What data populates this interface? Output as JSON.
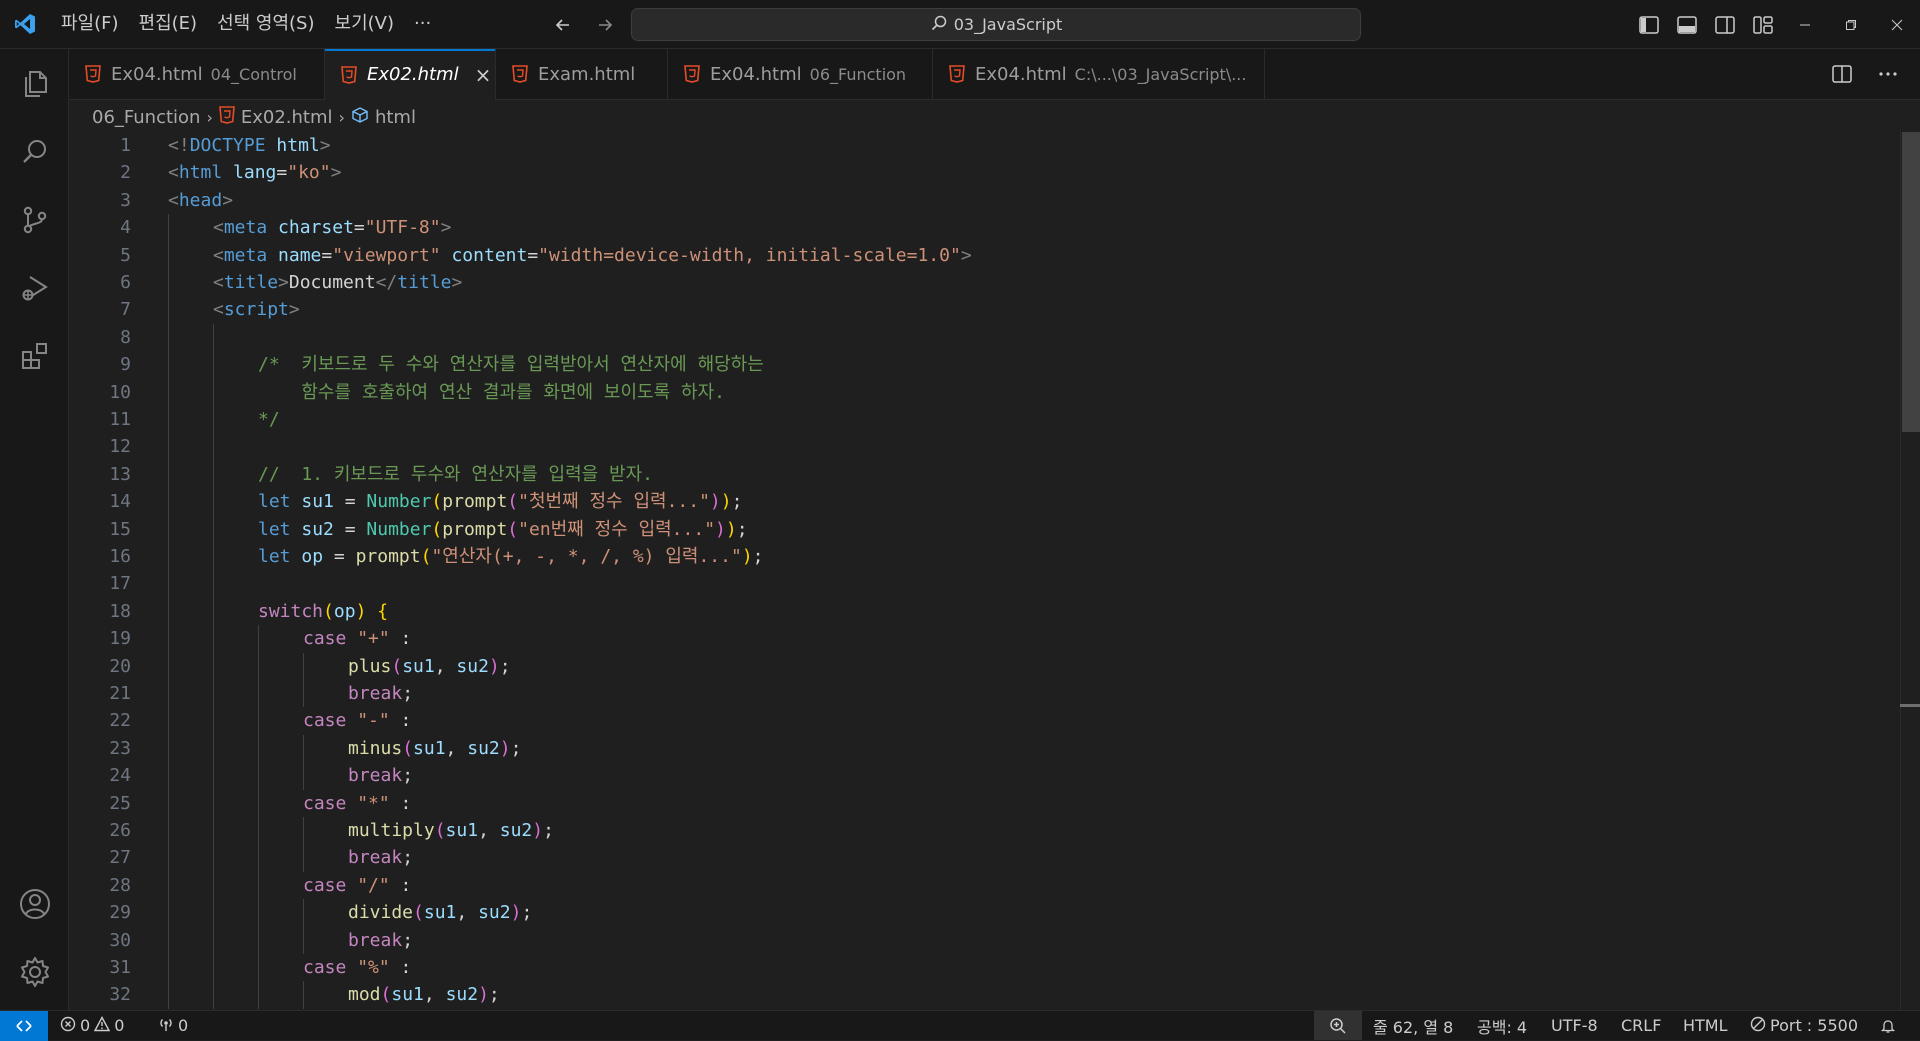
{
  "menu": [
    "파일(F)",
    "편집(E)",
    "선택 영역(S)",
    "보기(V)",
    "···"
  ],
  "command_center": {
    "label": "03_JavaScript",
    "icon": "search-icon"
  },
  "window_controls": [
    "minimize-icon",
    "restore-icon",
    "close-icon"
  ],
  "activity_bar": [
    "explorer-icon",
    "search-icon",
    "source-control-icon",
    "run-debug-icon",
    "extensions-icon",
    "account-icon",
    "settings-gear-icon"
  ],
  "tabs": [
    {
      "label": "Ex04.html",
      "description": "04_Control",
      "active": false
    },
    {
      "label": "Ex02.html",
      "description": "",
      "active": true,
      "close": "×"
    },
    {
      "label": "Exam.html",
      "description": "",
      "active": false
    },
    {
      "label": "Ex04.html",
      "description": "06_Function",
      "active": false
    },
    {
      "label": "Ex04.html",
      "description": "C:\\...\\03_JavaScript\\...",
      "active": false
    }
  ],
  "editor_actions": [
    "split-editor-icon",
    "more-actions-icon"
  ],
  "breadcrumb": {
    "folder": "06_Function",
    "file": "Ex02.html",
    "symbol": "html"
  },
  "code_lines": [
    {
      "n": 1,
      "indent": 0,
      "tokens": [
        [
          "t-punct",
          "<!"
        ],
        [
          "t-tag",
          "DOCTYPE"
        ],
        [
          "t-text",
          " "
        ],
        [
          "t-attr",
          "html"
        ],
        [
          "t-punct",
          ">"
        ]
      ]
    },
    {
      "n": 2,
      "indent": 0,
      "tokens": [
        [
          "t-punct",
          "<"
        ],
        [
          "t-tag",
          "html"
        ],
        [
          "t-text",
          " "
        ],
        [
          "t-attr",
          "lang"
        ],
        [
          "t-text",
          "="
        ],
        [
          "t-str",
          "\"ko\""
        ],
        [
          "t-punct",
          ">"
        ]
      ]
    },
    {
      "n": 3,
      "indent": 0,
      "tokens": [
        [
          "t-punct",
          "<"
        ],
        [
          "t-tag",
          "head"
        ],
        [
          "t-punct",
          ">"
        ]
      ]
    },
    {
      "n": 4,
      "indent": 1,
      "tokens": [
        [
          "t-punct",
          "<"
        ],
        [
          "t-tag",
          "meta"
        ],
        [
          "t-text",
          " "
        ],
        [
          "t-attr",
          "charset"
        ],
        [
          "t-text",
          "="
        ],
        [
          "t-str",
          "\"UTF-8\""
        ],
        [
          "t-punct",
          ">"
        ]
      ]
    },
    {
      "n": 5,
      "indent": 1,
      "tokens": [
        [
          "t-punct",
          "<"
        ],
        [
          "t-tag",
          "meta"
        ],
        [
          "t-text",
          " "
        ],
        [
          "t-attr",
          "name"
        ],
        [
          "t-text",
          "="
        ],
        [
          "t-str",
          "\"viewport\""
        ],
        [
          "t-text",
          " "
        ],
        [
          "t-attr",
          "content"
        ],
        [
          "t-text",
          "="
        ],
        [
          "t-str",
          "\"width=device-width, initial-scale=1.0\""
        ],
        [
          "t-punct",
          ">"
        ]
      ]
    },
    {
      "n": 6,
      "indent": 1,
      "tokens": [
        [
          "t-punct",
          "<"
        ],
        [
          "t-tag",
          "title"
        ],
        [
          "t-punct",
          ">"
        ],
        [
          "t-text",
          "Document"
        ],
        [
          "t-punct",
          "</"
        ],
        [
          "t-tag",
          "title"
        ],
        [
          "t-punct",
          ">"
        ]
      ]
    },
    {
      "n": 7,
      "indent": 1,
      "tokens": [
        [
          "t-punct",
          "<"
        ],
        [
          "t-tag",
          "script"
        ],
        [
          "t-punct",
          ">"
        ]
      ]
    },
    {
      "n": 8,
      "indent": 0,
      "tokens": []
    },
    {
      "n": 9,
      "indent": 2,
      "tokens": [
        [
          "t-com",
          "/*  키보드로 두 수와 연산자를 입력받아서 연산자에 해당하는"
        ]
      ]
    },
    {
      "n": 10,
      "indent": 2,
      "tokens": [
        [
          "t-com",
          "    함수를 호출하여 연산 결과를 화면에 보이도록 하자."
        ]
      ]
    },
    {
      "n": 11,
      "indent": 2,
      "tokens": [
        [
          "t-com",
          "*/"
        ]
      ]
    },
    {
      "n": 12,
      "indent": 0,
      "tokens": []
    },
    {
      "n": 13,
      "indent": 2,
      "tokens": [
        [
          "t-com",
          "//  1. 키보드로 두수와 연산자를 입력을 받자."
        ]
      ]
    },
    {
      "n": 14,
      "indent": 2,
      "tokens": [
        [
          "t-kw",
          "let"
        ],
        [
          "t-text",
          " "
        ],
        [
          "t-var",
          "su1"
        ],
        [
          "t-op",
          " = "
        ],
        [
          "t-cls",
          "Number"
        ],
        [
          "t-b1",
          "("
        ],
        [
          "t-fn",
          "prompt"
        ],
        [
          "t-b2",
          "("
        ],
        [
          "t-str",
          "\"첫번째 정수 입력...\""
        ],
        [
          "t-b2",
          ")"
        ],
        [
          "t-b1",
          ")"
        ],
        [
          "t-op",
          ";"
        ]
      ]
    },
    {
      "n": 15,
      "indent": 2,
      "tokens": [
        [
          "t-kw",
          "let"
        ],
        [
          "t-text",
          " "
        ],
        [
          "t-var",
          "su2"
        ],
        [
          "t-op",
          " = "
        ],
        [
          "t-cls",
          "Number"
        ],
        [
          "t-b1",
          "("
        ],
        [
          "t-fn",
          "prompt"
        ],
        [
          "t-b2",
          "("
        ],
        [
          "t-str",
          "\"en번째 정수 입력...\""
        ],
        [
          "t-b2",
          ")"
        ],
        [
          "t-b1",
          ")"
        ],
        [
          "t-op",
          ";"
        ]
      ]
    },
    {
      "n": 16,
      "indent": 2,
      "tokens": [
        [
          "t-kw",
          "let"
        ],
        [
          "t-text",
          " "
        ],
        [
          "t-var",
          "op"
        ],
        [
          "t-op",
          " = "
        ],
        [
          "t-fn",
          "prompt"
        ],
        [
          "t-b1",
          "("
        ],
        [
          "t-str",
          "\"연산자(+, -, *, /, %) 입력...\""
        ],
        [
          "t-b1",
          ")"
        ],
        [
          "t-op",
          ";"
        ]
      ]
    },
    {
      "n": 17,
      "indent": 0,
      "tokens": []
    },
    {
      "n": 18,
      "indent": 2,
      "tokens": [
        [
          "t-ctl",
          "switch"
        ],
        [
          "t-b1",
          "("
        ],
        [
          "t-var",
          "op"
        ],
        [
          "t-b1",
          ")"
        ],
        [
          "t-text",
          " "
        ],
        [
          "t-b1",
          "{"
        ]
      ]
    },
    {
      "n": 19,
      "indent": 3,
      "tokens": [
        [
          "t-ctl",
          "case"
        ],
        [
          "t-text",
          " "
        ],
        [
          "t-str",
          "\"+\""
        ],
        [
          "t-text",
          " :"
        ]
      ]
    },
    {
      "n": 20,
      "indent": 4,
      "tokens": [
        [
          "t-fn",
          "plus"
        ],
        [
          "t-b2",
          "("
        ],
        [
          "t-var",
          "su1"
        ],
        [
          "t-op",
          ", "
        ],
        [
          "t-var",
          "su2"
        ],
        [
          "t-b2",
          ")"
        ],
        [
          "t-op",
          ";"
        ]
      ]
    },
    {
      "n": 21,
      "indent": 4,
      "tokens": [
        [
          "t-ctl",
          "break"
        ],
        [
          "t-op",
          ";"
        ]
      ]
    },
    {
      "n": 22,
      "indent": 3,
      "tokens": [
        [
          "t-ctl",
          "case"
        ],
        [
          "t-text",
          " "
        ],
        [
          "t-str",
          "\"-\""
        ],
        [
          "t-text",
          " :"
        ]
      ]
    },
    {
      "n": 23,
      "indent": 4,
      "tokens": [
        [
          "t-fn",
          "minus"
        ],
        [
          "t-b2",
          "("
        ],
        [
          "t-var",
          "su1"
        ],
        [
          "t-op",
          ", "
        ],
        [
          "t-var",
          "su2"
        ],
        [
          "t-b2",
          ")"
        ],
        [
          "t-op",
          ";"
        ]
      ]
    },
    {
      "n": 24,
      "indent": 4,
      "tokens": [
        [
          "t-ctl",
          "break"
        ],
        [
          "t-op",
          ";"
        ]
      ]
    },
    {
      "n": 25,
      "indent": 3,
      "tokens": [
        [
          "t-ctl",
          "case"
        ],
        [
          "t-text",
          " "
        ],
        [
          "t-str",
          "\"*\""
        ],
        [
          "t-text",
          " :"
        ]
      ]
    },
    {
      "n": 26,
      "indent": 4,
      "tokens": [
        [
          "t-fn",
          "multiply"
        ],
        [
          "t-b2",
          "("
        ],
        [
          "t-var",
          "su1"
        ],
        [
          "t-op",
          ", "
        ],
        [
          "t-var",
          "su2"
        ],
        [
          "t-b2",
          ")"
        ],
        [
          "t-op",
          ";"
        ]
      ]
    },
    {
      "n": 27,
      "indent": 4,
      "tokens": [
        [
          "t-ctl",
          "break"
        ],
        [
          "t-op",
          ";"
        ]
      ]
    },
    {
      "n": 28,
      "indent": 3,
      "tokens": [
        [
          "t-ctl",
          "case"
        ],
        [
          "t-text",
          " "
        ],
        [
          "t-str",
          "\"/\""
        ],
        [
          "t-text",
          " :"
        ]
      ]
    },
    {
      "n": 29,
      "indent": 4,
      "tokens": [
        [
          "t-fn",
          "divide"
        ],
        [
          "t-b2",
          "("
        ],
        [
          "t-var",
          "su1"
        ],
        [
          "t-op",
          ", "
        ],
        [
          "t-var",
          "su2"
        ],
        [
          "t-b2",
          ")"
        ],
        [
          "t-op",
          ";"
        ]
      ]
    },
    {
      "n": 30,
      "indent": 4,
      "tokens": [
        [
          "t-ctl",
          "break"
        ],
        [
          "t-op",
          ";"
        ]
      ]
    },
    {
      "n": 31,
      "indent": 3,
      "tokens": [
        [
          "t-ctl",
          "case"
        ],
        [
          "t-text",
          " "
        ],
        [
          "t-str",
          "\"%\""
        ],
        [
          "t-text",
          " :"
        ]
      ]
    },
    {
      "n": 32,
      "indent": 4,
      "tokens": [
        [
          "t-fn",
          "mod"
        ],
        [
          "t-b2",
          "("
        ],
        [
          "t-var",
          "su1"
        ],
        [
          "t-op",
          ", "
        ],
        [
          "t-var",
          "su2"
        ],
        [
          "t-b2",
          ")"
        ],
        [
          "t-op",
          ";"
        ]
      ]
    }
  ],
  "status": {
    "errors": "0",
    "warnings": "0",
    "ports_forwarded": "0",
    "cursor": "줄 62, 열 8",
    "spaces": "공백: 4",
    "encoding": "UTF-8",
    "eol": "CRLF",
    "language": "HTML",
    "live_server": "Port : 5500"
  },
  "colors": {
    "accent": "#0078d4",
    "background": "#1f1f1f",
    "chrome": "#181818"
  }
}
